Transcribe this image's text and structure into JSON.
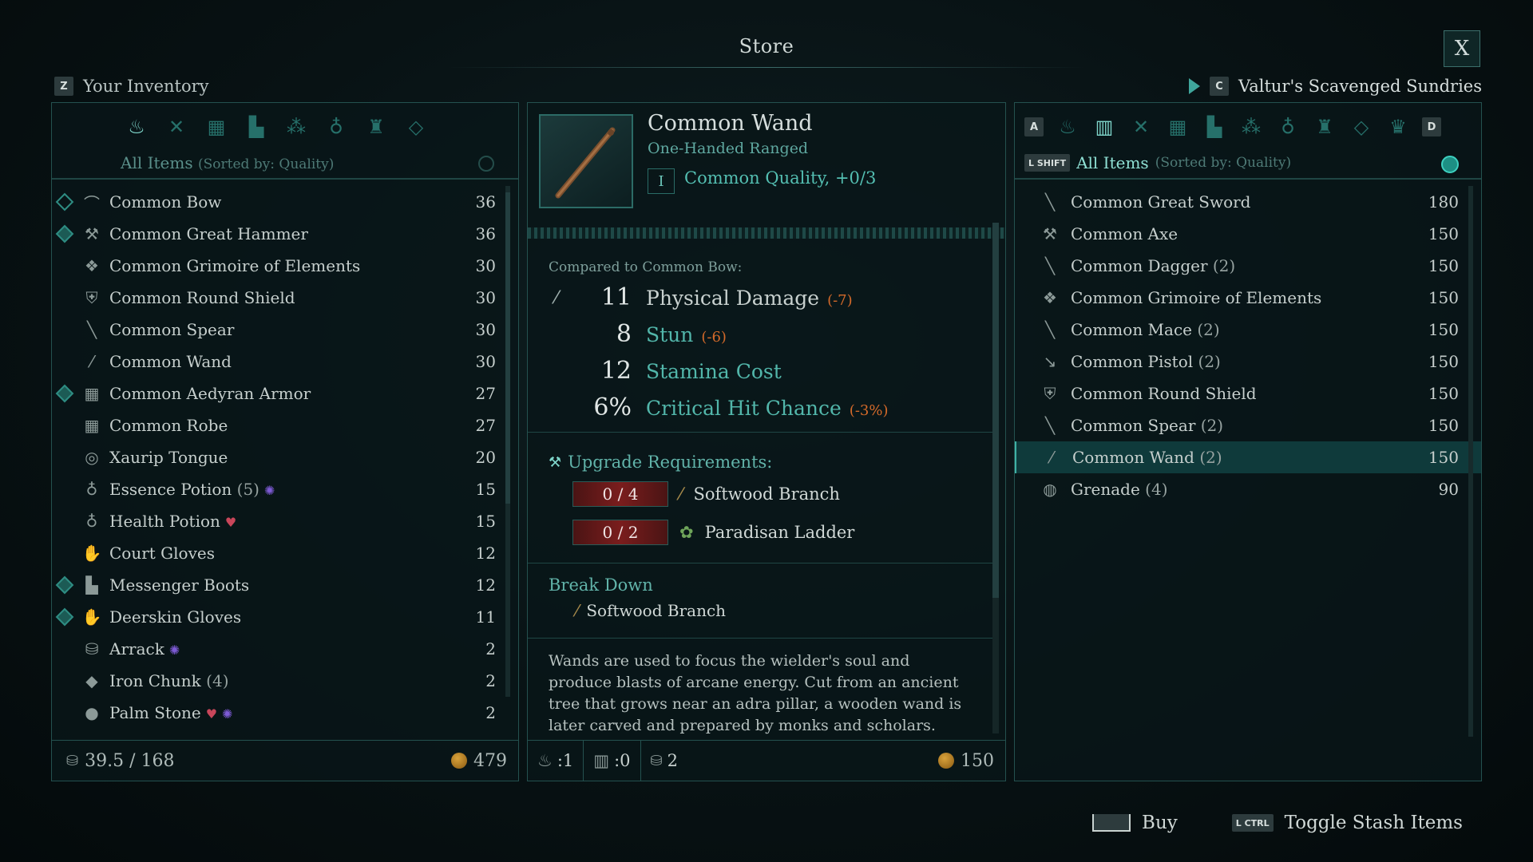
{
  "header": {
    "title": "Store",
    "close_label": "X"
  },
  "inventory": {
    "key": "Z",
    "title": "Your Inventory",
    "sort_main": "All Items",
    "sort_sub": "(Sorted by: Quality)",
    "categories": [
      "potion-bag-icon",
      "weapons-icon",
      "armor-icon",
      "boots-icon",
      "materials-icon",
      "consumables-icon",
      "lamp-icon",
      "gem-icon"
    ],
    "items": [
      {
        "icon": "bow-icon",
        "glyph": "⌒",
        "name": "Common Bow",
        "count": "",
        "value": "36",
        "mark": "outline"
      },
      {
        "icon": "hammer-icon",
        "glyph": "⚒",
        "name": "Common Great Hammer",
        "count": "",
        "value": "36",
        "mark": "filled"
      },
      {
        "icon": "grimoire-icon",
        "glyph": "❖",
        "name": "Common Grimoire of Elements",
        "count": "",
        "value": "30",
        "mark": ""
      },
      {
        "icon": "shield-icon",
        "glyph": "⛨",
        "name": "Common Round Shield",
        "count": "",
        "value": "30",
        "mark": ""
      },
      {
        "icon": "spear-icon",
        "glyph": "╲",
        "name": "Common Spear",
        "count": "",
        "value": "30",
        "mark": ""
      },
      {
        "icon": "wand-icon",
        "glyph": "⁄",
        "name": "Common Wand",
        "count": "",
        "value": "30",
        "mark": ""
      },
      {
        "icon": "armor-icon",
        "glyph": "▦",
        "name": "Common Aedyran Armor",
        "count": "",
        "value": "27",
        "mark": "filled"
      },
      {
        "icon": "robe-icon",
        "glyph": "▦",
        "name": "Common Robe",
        "count": "",
        "value": "27",
        "mark": ""
      },
      {
        "icon": "tongue-icon",
        "glyph": "◎",
        "name": "Xaurip Tongue",
        "count": "",
        "value": "20",
        "mark": ""
      },
      {
        "icon": "essence-potion-icon",
        "glyph": "♁",
        "name": "Essence Potion",
        "count": "(5)",
        "value": "15",
        "mark": "",
        "badge": "essence"
      },
      {
        "icon": "health-potion-icon",
        "glyph": "♁",
        "name": "Health Potion",
        "count": "",
        "value": "15",
        "mark": "",
        "badge": "health"
      },
      {
        "icon": "gloves-icon",
        "glyph": "✋",
        "name": "Court Gloves",
        "count": "",
        "value": "12",
        "mark": ""
      },
      {
        "icon": "boots-icon",
        "glyph": "▙",
        "name": "Messenger Boots",
        "count": "",
        "value": "12",
        "mark": "filled"
      },
      {
        "icon": "gloves-icon",
        "glyph": "✋",
        "name": "Deerskin Gloves",
        "count": "",
        "value": "11",
        "mark": "filled"
      },
      {
        "icon": "arrack-icon",
        "glyph": "⛁",
        "name": "Arrack",
        "count": "",
        "value": "2",
        "mark": "",
        "badge": "essence"
      },
      {
        "icon": "iron-chunk-icon",
        "glyph": "◆",
        "name": "Iron Chunk",
        "count": "(4)",
        "value": "2",
        "mark": ""
      },
      {
        "icon": "palm-stone-icon",
        "glyph": "●",
        "name": "Palm Stone",
        "count": "",
        "value": "2",
        "mark": "",
        "badge": "both"
      }
    ],
    "weight": "39.5 / 168",
    "gold": "479"
  },
  "detail": {
    "name": "Common Wand",
    "type": "One-Handed Ranged",
    "tier": "I",
    "quality": "Common Quality, +0/3",
    "compared_to": "Compared to Common Bow:",
    "stats": [
      {
        "value": "11",
        "label": "Physical Damage",
        "diff": "(-7)",
        "style": "white"
      },
      {
        "value": "8",
        "label": "Stun",
        "diff": "(-6)",
        "style": "teal"
      },
      {
        "value": "12",
        "label": "Stamina Cost",
        "diff": "",
        "style": "teal"
      },
      {
        "value": "6%",
        "label": "Critical Hit Chance",
        "diff": "(-3%)",
        "style": "teal"
      }
    ],
    "upgrade_title": "Upgrade Requirements:",
    "requirements": [
      {
        "have": "0 / 4",
        "name": "Softwood Branch",
        "icon": "softwood-branch-icon"
      },
      {
        "have": "0 / 2",
        "name": "Paradisan Ladder",
        "icon": "paradisan-ladder-icon"
      }
    ],
    "breakdown_title": "Break Down",
    "breakdown_item": "Softwood Branch",
    "description": "Wands are used to focus the wielder's soul and produce blasts of arcane energy. Cut from an ancient tree that grows near an adra pillar, a wooden wand is later carved and prepared by monks and scholars. Some wizards craft",
    "footer": {
      "potions": ":1",
      "chest": ":0",
      "weight": "2",
      "price": "150"
    }
  },
  "vendor": {
    "key": "C",
    "name": "Valtur's Scavenged Sundries",
    "left_key": "A",
    "right_key": "D",
    "shift_key": "L SHIFT",
    "sort_main": "All Items",
    "sort_sub": "(Sorted by: Quality)",
    "categories": [
      "potion-bag-icon",
      "stash-icon",
      "weapons-icon",
      "armor-icon",
      "boots-icon",
      "materials-icon",
      "consumables-icon",
      "lamp-icon",
      "gem-icon",
      "crown-icon"
    ],
    "items": [
      {
        "icon": "great-sword-icon",
        "glyph": "╲",
        "name": "Common Great Sword",
        "count": "",
        "value": "180"
      },
      {
        "icon": "axe-icon",
        "glyph": "⚒",
        "name": "Common Axe",
        "count": "",
        "value": "150"
      },
      {
        "icon": "dagger-icon",
        "glyph": "╲",
        "name": "Common Dagger",
        "count": "(2)",
        "value": "150"
      },
      {
        "icon": "grimoire-icon",
        "glyph": "❖",
        "name": "Common Grimoire of Elements",
        "count": "",
        "value": "150"
      },
      {
        "icon": "mace-icon",
        "glyph": "╲",
        "name": "Common Mace",
        "count": "(2)",
        "value": "150"
      },
      {
        "icon": "pistol-icon",
        "glyph": "↘",
        "name": "Common Pistol",
        "count": "(2)",
        "value": "150"
      },
      {
        "icon": "shield-icon",
        "glyph": "⛨",
        "name": "Common Round Shield",
        "count": "",
        "value": "150"
      },
      {
        "icon": "spear-icon",
        "glyph": "╲",
        "name": "Common Spear",
        "count": "(2)",
        "value": "150"
      },
      {
        "icon": "wand-icon",
        "glyph": "⁄",
        "name": "Common Wand",
        "count": "(2)",
        "value": "150",
        "selected": true
      },
      {
        "icon": "grenade-icon",
        "glyph": "◍",
        "name": "Grenade",
        "count": "(4)",
        "value": "90"
      }
    ]
  },
  "prompts": {
    "buy_label": "Buy",
    "stash_key": "L CTRL",
    "stash_label": "Toggle Stash Items"
  },
  "colors": {
    "accent": "#3fb1a5",
    "negative": "#d46a2a",
    "gold": "#d9a23b"
  }
}
